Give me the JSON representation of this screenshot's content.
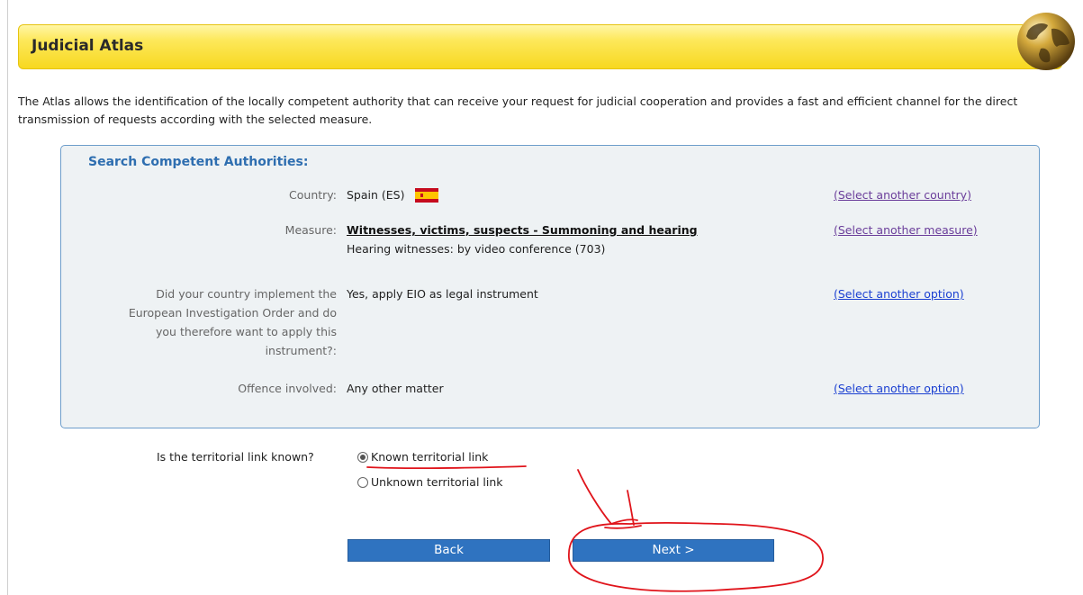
{
  "header": {
    "title": "Judicial Atlas"
  },
  "intro": {
    "text": "The Atlas allows the identification of the locally competent authority that can receive your request for judicial cooperation and provides a fast and efficient channel for the direct transmission of requests according with the selected measure."
  },
  "search": {
    "title": "Search Competent Authorities:",
    "country": {
      "label": "Country:",
      "value": "Spain (ES)",
      "flag_icon": "spain-flag-icon",
      "link": "(Select another country)"
    },
    "measure": {
      "label": "Measure:",
      "value": "Witnesses, victims, suspects - Summoning and hearing",
      "detail": "Hearing witnesses: by video conference (703)",
      "link": "(Select another measure)"
    },
    "eio": {
      "label_lines": [
        "Did your country implement the",
        "European Investigation Order and do",
        "you therefore want to apply this",
        "instrument?:"
      ],
      "value": "Yes, apply EIO as legal instrument",
      "link": "(Select another option)"
    },
    "offence": {
      "label": "Offence involved:",
      "value": "Any other matter",
      "link": "(Select another option)"
    }
  },
  "territorial": {
    "label": "Is the territorial link known?",
    "options": [
      {
        "label": "Known territorial link",
        "selected": true
      },
      {
        "label": "Unknown territorial link",
        "selected": false
      }
    ]
  },
  "buttons": {
    "back": "Back",
    "next": "Next >"
  },
  "colors": {
    "banner": "#fde85a",
    "button": "#2f73c0",
    "section_title": "#2e6eb0",
    "annotation": "#e0141b"
  }
}
